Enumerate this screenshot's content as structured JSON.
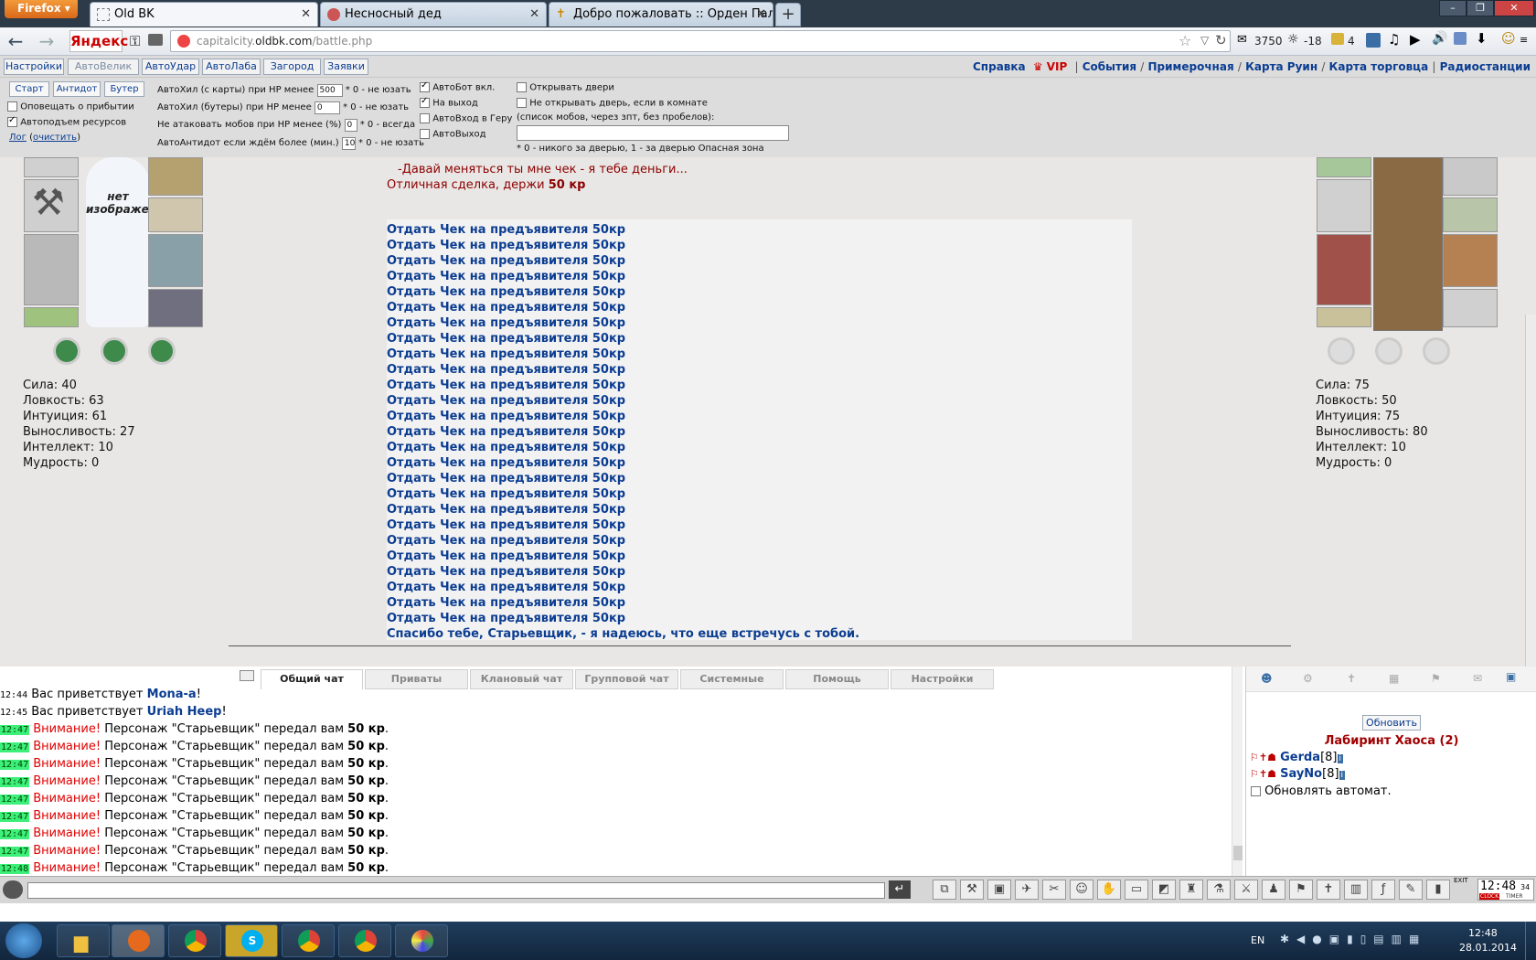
{
  "browser": {
    "button": "Firefox",
    "tabs": [
      "Old BK",
      "Несносный дед",
      "Добро пожаловать :: Орден Паладинов"
    ],
    "search_engine": "Яндекс",
    "url_prefix": "capitalcity.",
    "url_domain": "oldbk.com",
    "url_path": "/battle.php",
    "mail_count": "3750",
    "weather": "-18",
    "notif_count": "4"
  },
  "menu": {
    "buttons": [
      "Настройки",
      "АвтоВелик",
      "АвтоУдар",
      "АвтоЛаба",
      "Загород",
      "Заявки"
    ],
    "links": [
      "Справка",
      "События",
      "Примерочная",
      "Карта Руин",
      "Карта торговца",
      "Радиостанции"
    ]
  },
  "settings": {
    "buttons": [
      "Старт",
      "Антидот",
      "Бутер"
    ],
    "notify_arrival": "Оповещать о прибытии",
    "auto_pickup": "Автоподъем ресурсов",
    "log": "Лог",
    "clear": "очистить",
    "heal_map_label": "АвтоХил (с карты) при HP менее",
    "heal_map_value": "500",
    "heal_map_hint": "* 0 - не юзать",
    "heal_food_label": "АвтоХил (бутеры) при HP менее",
    "heal_food_value": "0",
    "heal_food_hint": "* 0 - не юзать",
    "no_attack_label": "Не атаковать мобов при HP менее (%)",
    "no_attack_value": "0",
    "no_attack_hint": "* 0 - всегда",
    "antidote_label": "АвтоАнтидот если ждём более (мин.)",
    "antidote_value": "10",
    "antidote_hint": "* 0 - не юзать",
    "autobot": "АвтоБот вкл.",
    "on_exit": "На выход",
    "auto_enter": "АвтоВход в Геру",
    "auto_exit": "АвтоВыход",
    "open_doors": "Открывать двери",
    "dont_open": "Не открывать дверь, если в комнате",
    "mobs_list": "(список мобов, через зпт, без пробелов):",
    "door_hint": "* 0 - никого за дверью, 1 - за дверью Опасная зона"
  },
  "left_player": {
    "no_image": "нет изображения",
    "stats": [
      "Сила: 40",
      "Ловкость: 63",
      "Интуиция: 61",
      "Выносливость: 27",
      "Интеллект: 10",
      "Мудрость: 0"
    ]
  },
  "right_player": {
    "stats": [
      "Сила: 75",
      "Ловкость: 50",
      "Интуиция: 75",
      "Выносливость: 80",
      "Интеллект: 10",
      "Мудрость: 0"
    ]
  },
  "dialog": {
    "line1": "-Давай меняться ты мне чек - я тебе деньги...",
    "line2_text": "Отличная сделка, держи ",
    "line2_amount": "50 кр",
    "offer": "Отдать Чек на предъявителя 50кр",
    "offer_count": 26,
    "farewell": "Спасибо тебе, Старьевщик, - я надеюсь, что еще встречусь с тобой."
  },
  "chat": {
    "tabs": [
      "Общий чат",
      "Приваты",
      "Клановый чат",
      "Групповой чат",
      "Системные",
      "Помощь",
      "Настройки"
    ],
    "greet1_time": "12:44",
    "greet1_text": "Вас приветствует ",
    "greet1_name": "Mona-a",
    "greet2_time": "12:45",
    "greet2_text": "Вас приветствует ",
    "greet2_name": "Uriah Heep",
    "warn_times": [
      "12:47",
      "12:47",
      "12:47",
      "12:47",
      "12:47",
      "12:47",
      "12:47",
      "12:47",
      "12:48"
    ],
    "warn_label": "Внимание!",
    "warn_text": " Персонаж \"Старьевщик\" передал вам ",
    "warn_amount": "50 кр"
  },
  "room": {
    "refresh": "Обновить",
    "name": "Лабиринт Хаоса (2)",
    "players": [
      {
        "name": "Gerda",
        "level": "[8]"
      },
      {
        "name": "SayNo",
        "level": "[8]"
      }
    ],
    "auto_refresh": "Обновлять автомат."
  },
  "clock": {
    "time": "12:48",
    "seconds": "34",
    "label1": "CLOCK",
    "label2": "TIMER",
    "exit": "EXIT"
  },
  "taskbar": {
    "lang": "EN",
    "time": "12:48",
    "date": "28.01.2014"
  },
  "colors": {
    "link": "#0b3d91",
    "warning": "#e00000",
    "dialog": "#8b0000"
  }
}
